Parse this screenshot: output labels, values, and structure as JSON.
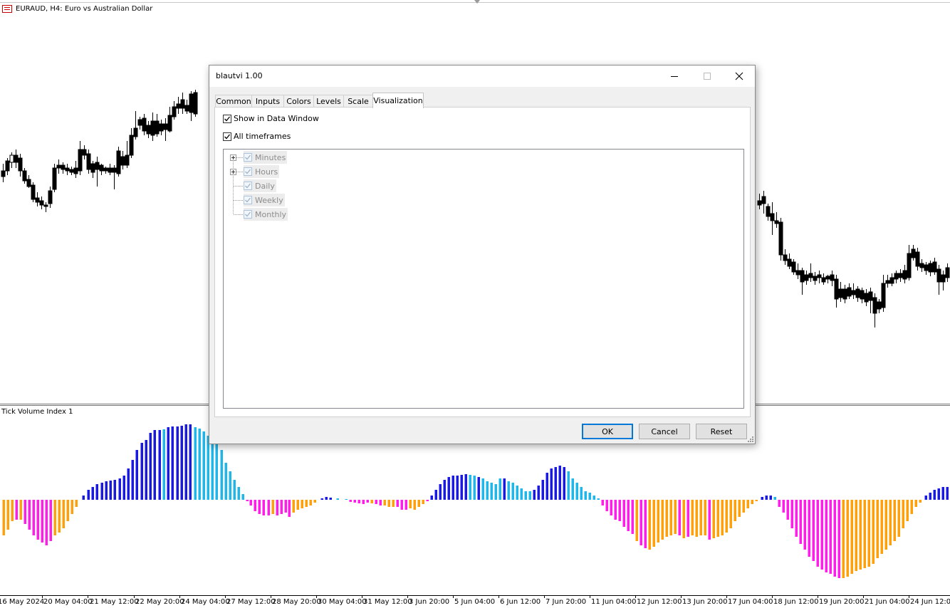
{
  "chart": {
    "symbol_title": "EURAUD, H4:  Euro vs Australian Dollar",
    "subwindow_title": "Tick Volume Index 1",
    "time_labels": [
      "16 May 2024",
      "20 May 04:00",
      "21 May 12:00",
      "22 May 20:00",
      "24 May 04:00",
      "27 May 12:00",
      "28 May 20:00",
      "30 May 04:00",
      "31 May 12:00",
      "3 Jun 20:00",
      "5 Jun 04:00",
      "6 Jun 12:00",
      "7 Jun 20:00",
      "11 Jun 04:00",
      "12 Jun 12:00",
      "13 Jun 20:00",
      "17 Jun 04:00",
      "18 Jun 12:00",
      "19 Jun 20:00",
      "21 Jun 04:00",
      "24 Jun 12:00"
    ],
    "colors": {
      "bull_strong": "#1a1adf",
      "bull_weak": "#1fb7ea",
      "bear_strong": "#ff1ee8",
      "bear_weak": "#ff9f0a"
    }
  },
  "dialog": {
    "title": "blautvi 1.00",
    "tabs": [
      "Common",
      "Inputs",
      "Colors",
      "Levels",
      "Scale",
      "Visualization"
    ],
    "active_tab": "Visualization",
    "show_in_data_window": {
      "label": "Show in Data Window",
      "checked": true
    },
    "all_timeframes": {
      "label": "All timeframes",
      "checked": true
    },
    "timeframes": [
      {
        "label": "Minutes",
        "checked": true,
        "expandable": true
      },
      {
        "label": "Hours",
        "checked": true,
        "expandable": true
      },
      {
        "label": "Daily",
        "checked": true,
        "expandable": false
      },
      {
        "label": "Weekly",
        "checked": true,
        "expandable": false
      },
      {
        "label": "Monthly",
        "checked": true,
        "expandable": false
      }
    ],
    "buttons": {
      "ok": "OK",
      "cancel": "Cancel",
      "reset": "Reset"
    }
  }
}
